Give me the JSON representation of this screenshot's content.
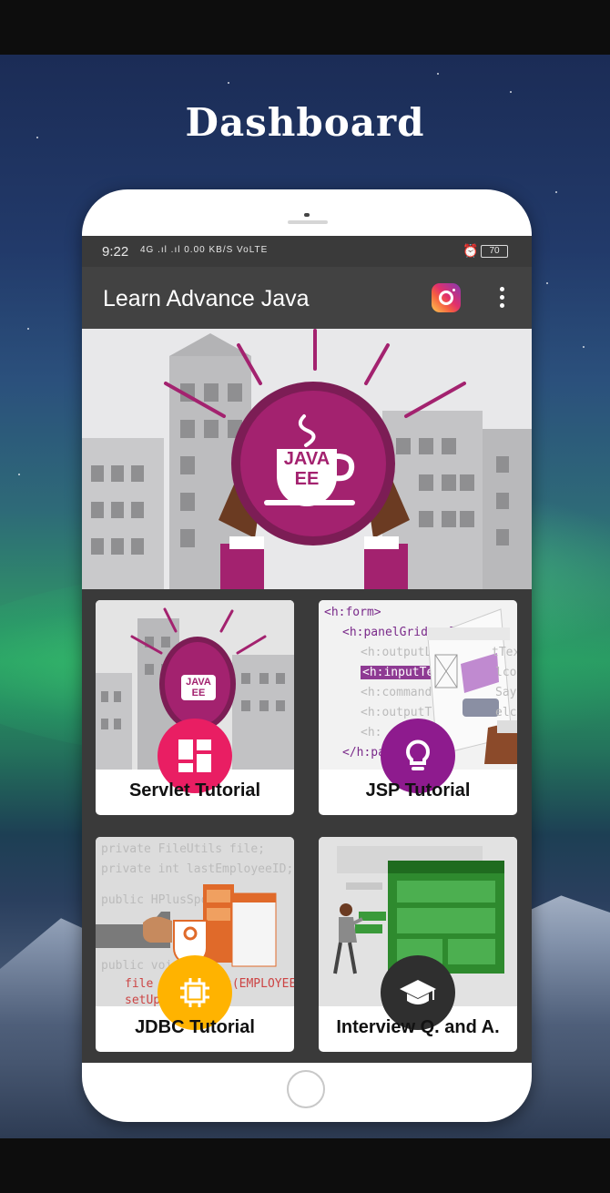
{
  "headline": "Dashboard",
  "status_bar": {
    "time": "9:22",
    "signal_text": "4G .ıl .ıl 0.00 KB/S VoLTE",
    "battery": "70"
  },
  "app_bar": {
    "title": "Learn Advance Java",
    "instagram_icon": "instagram-icon",
    "overflow_icon": "more-vert-icon"
  },
  "hero": {
    "logo_line1": "JAVA",
    "logo_line2": "EE"
  },
  "cards": [
    {
      "label": "Servlet Tutorial",
      "icon": "dashboard-icon",
      "color": "#e91e63",
      "logo_line1": "JAVA",
      "logo_line2": "EE"
    },
    {
      "label": "JSP Tutorial",
      "icon": "lightbulb-icon",
      "color": "#8e1b8e",
      "code": [
        "<h:form>",
        "<h:panelGrid colum",
        "<h:outputLab",
        "<h:inputText",
        "<h:commandB",
        "<h:outputT",
        "<h:",
        "</h:pan"
      ],
      "code_right": [
        "tTex",
        "lcom",
        "Say",
        "elco"
      ]
    },
    {
      "label": "JDBC Tutorial",
      "icon": "memory-chip-icon",
      "color": "#ffb300",
      "code": [
        "private FileUtils file;",
        "private int lastEmployeeID;",
        "public HPlusSport",
        "public void",
        "file = ",
        "setUpF"
      ],
      "code_right": "s(EMPLOYEES"
    },
    {
      "label": "Interview Q. and A.",
      "icon": "graduation-cap-icon",
      "color": "#2f2f2f"
    }
  ],
  "colors": {
    "app_bar": "#424242",
    "status_bar": "#3a3a3a",
    "java_magenta": "#a3226f"
  }
}
